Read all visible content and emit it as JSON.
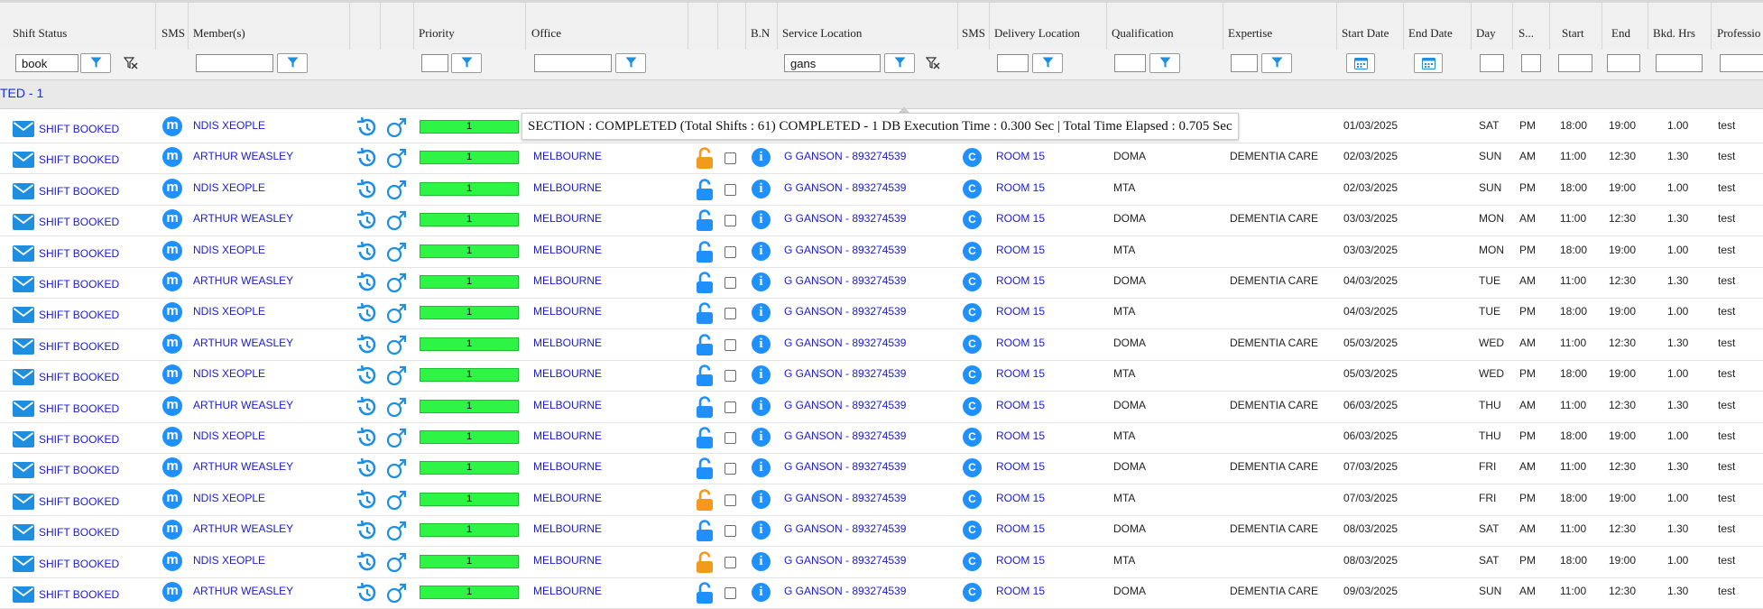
{
  "columns": {
    "shift_status": "Shift Status",
    "sms1": "SMS",
    "members": "Member(s)",
    "priority": "Priority",
    "office": "Office",
    "bn": "B.N",
    "service_location": "Service Location",
    "sms2": "SMS",
    "delivery_location": "Delivery Location",
    "qualification": "Qualification",
    "expertise": "Expertise",
    "start_date": "Start Date",
    "end_date": "End Date",
    "day": "Day",
    "s": "S...",
    "start": "Start",
    "end": "End",
    "bkd_hrs": "Bkd. Hrs",
    "profession": "Professio"
  },
  "filters": {
    "shift_status": "book",
    "service_location": "gans"
  },
  "group_label": "TED - 1",
  "tooltip": "SECTION : COMPLETED (Total Shifts : 61) COMPLETED - 1 DB Execution Time : 0.300 Sec | Total Time Elapsed : 0.705 Sec",
  "colors": {
    "accent": "#1e90ff",
    "link": "#1a1ad6",
    "priority_bar": "#2ef545",
    "lock_orange": "#f39a1e"
  },
  "icons": {
    "status": "envelope-icon",
    "sms": "messenger-icon",
    "history": "history-icon",
    "gender": "male-icon",
    "lock": "lock-icon",
    "info": "info-icon",
    "filter": "filter-icon",
    "clear_filter": "filter-clear-icon",
    "calendar": "calendar-icon"
  },
  "rows": [
    {
      "status": "SHIFT BOOKED",
      "member": "NDIS XEOPLE",
      "priority": "1",
      "office": "",
      "locked": "orange",
      "service": "",
      "sms": "",
      "delivery": "",
      "qualification": "",
      "expertise": "",
      "start_date": "01/03/2025",
      "end_date": "",
      "day": "SAT",
      "s": "PM",
      "start": "18:00",
      "end": "19:00",
      "hrs": "1.00",
      "profession": "test"
    },
    {
      "status": "SHIFT BOOKED",
      "member": "ARTHUR WEASLEY",
      "priority": "1",
      "office": "MELBOURNE",
      "locked": "orange",
      "service": "G GANSON - 893274539",
      "sms": "C",
      "delivery": "ROOM 15",
      "qualification": "DOMA",
      "expertise": "DEMENTIA CARE",
      "start_date": "02/03/2025",
      "end_date": "",
      "day": "SUN",
      "s": "AM",
      "start": "11:00",
      "end": "12:30",
      "hrs": "1.30",
      "profession": "test"
    },
    {
      "status": "SHIFT BOOKED",
      "member": "NDIS XEOPLE",
      "priority": "1",
      "office": "MELBOURNE",
      "locked": "blue",
      "service": "G GANSON - 893274539",
      "sms": "C",
      "delivery": "ROOM 15",
      "qualification": "MTA",
      "expertise": "",
      "start_date": "02/03/2025",
      "end_date": "",
      "day": "SUN",
      "s": "PM",
      "start": "18:00",
      "end": "19:00",
      "hrs": "1.00",
      "profession": "test"
    },
    {
      "status": "SHIFT BOOKED",
      "member": "ARTHUR WEASLEY",
      "priority": "1",
      "office": "MELBOURNE",
      "locked": "blue",
      "service": "G GANSON - 893274539",
      "sms": "C",
      "delivery": "ROOM 15",
      "qualification": "DOMA",
      "expertise": "DEMENTIA CARE",
      "start_date": "03/03/2025",
      "end_date": "",
      "day": "MON",
      "s": "AM",
      "start": "11:00",
      "end": "12:30",
      "hrs": "1.30",
      "profession": "test"
    },
    {
      "status": "SHIFT BOOKED",
      "member": "NDIS XEOPLE",
      "priority": "1",
      "office": "MELBOURNE",
      "locked": "blue",
      "service": "G GANSON - 893274539",
      "sms": "C",
      "delivery": "ROOM 15",
      "qualification": "MTA",
      "expertise": "",
      "start_date": "03/03/2025",
      "end_date": "",
      "day": "MON",
      "s": "PM",
      "start": "18:00",
      "end": "19:00",
      "hrs": "1.00",
      "profession": "test"
    },
    {
      "status": "SHIFT BOOKED",
      "member": "ARTHUR WEASLEY",
      "priority": "1",
      "office": "MELBOURNE",
      "locked": "blue",
      "service": "G GANSON - 893274539",
      "sms": "C",
      "delivery": "ROOM 15",
      "qualification": "DOMA",
      "expertise": "DEMENTIA CARE",
      "start_date": "04/03/2025",
      "end_date": "",
      "day": "TUE",
      "s": "AM",
      "start": "11:00",
      "end": "12:30",
      "hrs": "1.30",
      "profession": "test"
    },
    {
      "status": "SHIFT BOOKED",
      "member": "NDIS XEOPLE",
      "priority": "1",
      "office": "MELBOURNE",
      "locked": "blue",
      "service": "G GANSON - 893274539",
      "sms": "C",
      "delivery": "ROOM 15",
      "qualification": "MTA",
      "expertise": "",
      "start_date": "04/03/2025",
      "end_date": "",
      "day": "TUE",
      "s": "PM",
      "start": "18:00",
      "end": "19:00",
      "hrs": "1.00",
      "profession": "test"
    },
    {
      "status": "SHIFT BOOKED",
      "member": "ARTHUR WEASLEY",
      "priority": "1",
      "office": "MELBOURNE",
      "locked": "blue",
      "service": "G GANSON - 893274539",
      "sms": "C",
      "delivery": "ROOM 15",
      "qualification": "DOMA",
      "expertise": "DEMENTIA CARE",
      "start_date": "05/03/2025",
      "end_date": "",
      "day": "WED",
      "s": "AM",
      "start": "11:00",
      "end": "12:30",
      "hrs": "1.30",
      "profession": "test"
    },
    {
      "status": "SHIFT BOOKED",
      "member": "NDIS XEOPLE",
      "priority": "1",
      "office": "MELBOURNE",
      "locked": "blue",
      "service": "G GANSON - 893274539",
      "sms": "C",
      "delivery": "ROOM 15",
      "qualification": "MTA",
      "expertise": "",
      "start_date": "05/03/2025",
      "end_date": "",
      "day": "WED",
      "s": "PM",
      "start": "18:00",
      "end": "19:00",
      "hrs": "1.00",
      "profession": "test"
    },
    {
      "status": "SHIFT BOOKED",
      "member": "ARTHUR WEASLEY",
      "priority": "1",
      "office": "MELBOURNE",
      "locked": "blue",
      "service": "G GANSON - 893274539",
      "sms": "C",
      "delivery": "ROOM 15",
      "qualification": "DOMA",
      "expertise": "DEMENTIA CARE",
      "start_date": "06/03/2025",
      "end_date": "",
      "day": "THU",
      "s": "AM",
      "start": "11:00",
      "end": "12:30",
      "hrs": "1.30",
      "profession": "test"
    },
    {
      "status": "SHIFT BOOKED",
      "member": "NDIS XEOPLE",
      "priority": "1",
      "office": "MELBOURNE",
      "locked": "blue",
      "service": "G GANSON - 893274539",
      "sms": "C",
      "delivery": "ROOM 15",
      "qualification": "MTA",
      "expertise": "",
      "start_date": "06/03/2025",
      "end_date": "",
      "day": "THU",
      "s": "PM",
      "start": "18:00",
      "end": "19:00",
      "hrs": "1.00",
      "profession": "test"
    },
    {
      "status": "SHIFT BOOKED",
      "member": "ARTHUR WEASLEY",
      "priority": "1",
      "office": "MELBOURNE",
      "locked": "blue",
      "service": "G GANSON - 893274539",
      "sms": "C",
      "delivery": "ROOM 15",
      "qualification": "DOMA",
      "expertise": "DEMENTIA CARE",
      "start_date": "07/03/2025",
      "end_date": "",
      "day": "FRI",
      "s": "AM",
      "start": "11:00",
      "end": "12:30",
      "hrs": "1.30",
      "profession": "test"
    },
    {
      "status": "SHIFT BOOKED",
      "member": "NDIS XEOPLE",
      "priority": "1",
      "office": "MELBOURNE",
      "locked": "orange",
      "service": "G GANSON - 893274539",
      "sms": "C",
      "delivery": "ROOM 15",
      "qualification": "MTA",
      "expertise": "",
      "start_date": "07/03/2025",
      "end_date": "",
      "day": "FRI",
      "s": "PM",
      "start": "18:00",
      "end": "19:00",
      "hrs": "1.00",
      "profession": "test"
    },
    {
      "status": "SHIFT BOOKED",
      "member": "ARTHUR WEASLEY",
      "priority": "1",
      "office": "MELBOURNE",
      "locked": "blue",
      "service": "G GANSON - 893274539",
      "sms": "C",
      "delivery": "ROOM 15",
      "qualification": "DOMA",
      "expertise": "DEMENTIA CARE",
      "start_date": "08/03/2025",
      "end_date": "",
      "day": "SAT",
      "s": "AM",
      "start": "11:00",
      "end": "12:30",
      "hrs": "1.30",
      "profession": "test"
    },
    {
      "status": "SHIFT BOOKED",
      "member": "NDIS XEOPLE",
      "priority": "1",
      "office": "MELBOURNE",
      "locked": "orange",
      "service": "G GANSON - 893274539",
      "sms": "C",
      "delivery": "ROOM 15",
      "qualification": "MTA",
      "expertise": "",
      "start_date": "08/03/2025",
      "end_date": "",
      "day": "SAT",
      "s": "PM",
      "start": "18:00",
      "end": "19:00",
      "hrs": "1.00",
      "profession": "test"
    },
    {
      "status": "SHIFT BOOKED",
      "member": "ARTHUR WEASLEY",
      "priority": "1",
      "office": "MELBOURNE",
      "locked": "blue",
      "service": "G GANSON - 893274539",
      "sms": "C",
      "delivery": "ROOM 15",
      "qualification": "DOMA",
      "expertise": "DEMENTIA CARE",
      "start_date": "09/03/2025",
      "end_date": "",
      "day": "SUN",
      "s": "AM",
      "start": "11:00",
      "end": "12:30",
      "hrs": "1.30",
      "profession": "test"
    }
  ]
}
